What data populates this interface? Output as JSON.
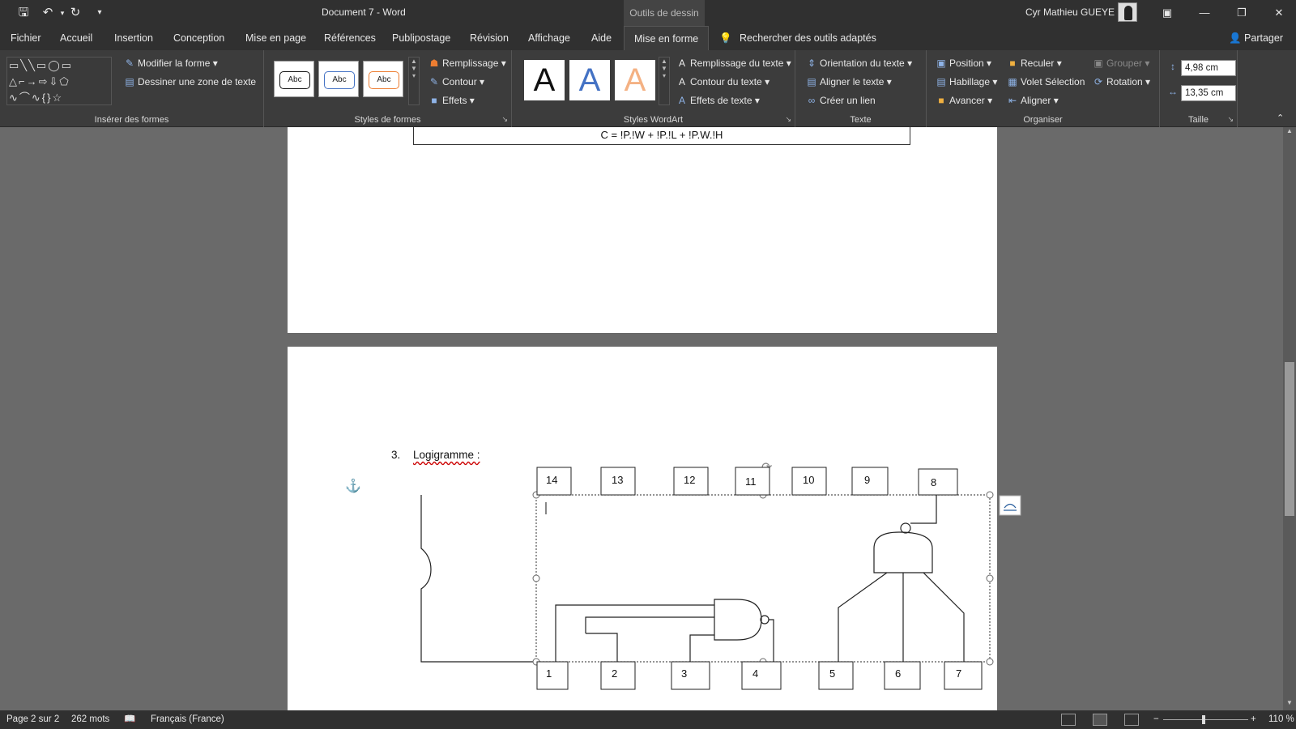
{
  "titlebar": {
    "document_title": "Document 7  -  Word",
    "context_tab": "Outils de dessin",
    "user_name": "Cyr Mathieu GUEYE",
    "quick_access": [
      "save-icon",
      "undo-icon",
      "redo-icon",
      "customize-icon"
    ]
  },
  "tabs": [
    "Fichier",
    "Accueil",
    "Insertion",
    "Conception",
    "Mise en page",
    "Références",
    "Publipostage",
    "Révision",
    "Affichage",
    "Aide",
    "Mise en forme"
  ],
  "active_tab": "Mise en forme",
  "tell_me": "Rechercher des outils adaptés",
  "share": "Partager",
  "ribbon": {
    "insert_shapes": {
      "label": "Insérer des formes",
      "edit_shape": "Modifier la forme",
      "draw_textbox": "Dessiner une zone de texte"
    },
    "shape_styles": {
      "label": "Styles de formes",
      "previews": [
        "Abc",
        "Abc",
        "Abc"
      ],
      "fill": "Remplissage",
      "outline": "Contour",
      "effects": "Effets"
    },
    "wordart_styles": {
      "label": "Styles WordArt",
      "previews": [
        "A",
        "A",
        "A"
      ],
      "text_fill": "Remplissage du texte",
      "text_outline": "Contour du texte",
      "text_effects": "Effets de texte"
    },
    "text": {
      "label": "Texte",
      "direction": "Orientation du texte",
      "align": "Aligner le texte",
      "link": "Créer un lien"
    },
    "arrange": {
      "label": "Organiser",
      "position": "Position",
      "wrap": "Habillage",
      "forward": "Avancer",
      "backward": "Reculer",
      "selection_pane": "Volet Sélection",
      "align": "Aligner",
      "group": "Grouper",
      "rotate": "Rotation"
    },
    "size": {
      "label": "Taille",
      "height": "4,98 cm",
      "width": "13,35 cm"
    }
  },
  "document": {
    "equation": "C = !P.!W + !P.!L + !P.W.!H",
    "section_number": "3.",
    "section_title": "Logigramme :",
    "pins_top": [
      "14",
      "13",
      "12",
      "11",
      "10",
      "9",
      "8"
    ],
    "pins_bottom": [
      "1",
      "2",
      "3",
      "4",
      "5",
      "6",
      "7"
    ]
  },
  "status": {
    "page": "Page 2 sur 2",
    "words": "262 mots",
    "language": "Français (France)",
    "zoom": "110 %"
  },
  "colors": {
    "chrome_dark": "#303030",
    "ribbon": "#3c3c3c",
    "doc_background": "#6a6a6a",
    "wordart_blue": "#4472c4",
    "wordart_orange": "#f4b183",
    "style_blue": "#4472c4",
    "style_orange": "#ed7d31"
  }
}
